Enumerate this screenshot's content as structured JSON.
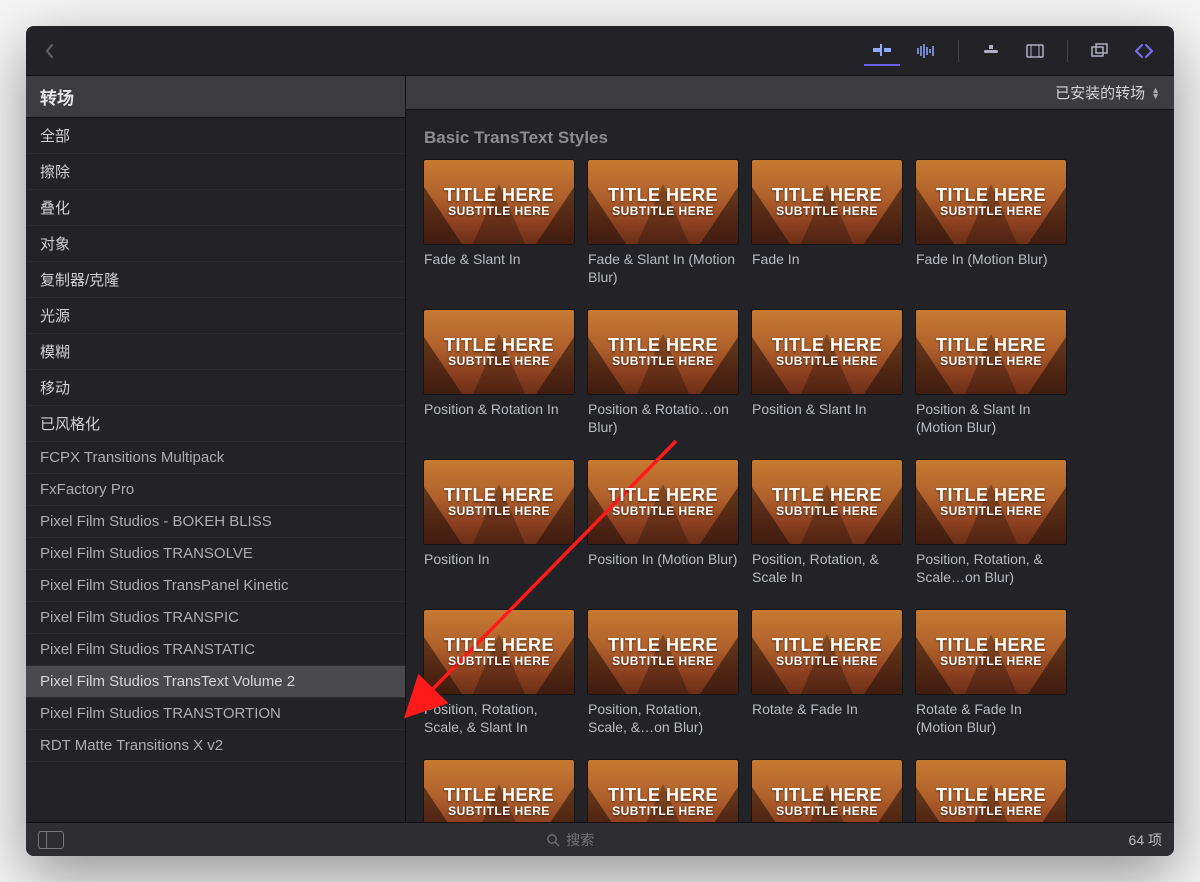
{
  "header": {
    "filter_label": "已安装的转场"
  },
  "sidebar": {
    "title": "转场",
    "items": [
      {
        "label": "全部",
        "top": true
      },
      {
        "label": "擦除",
        "top": true
      },
      {
        "label": "叠化",
        "top": true
      },
      {
        "label": "对象",
        "top": true
      },
      {
        "label": "复制器/克隆",
        "top": true
      },
      {
        "label": "光源",
        "top": true
      },
      {
        "label": "模糊",
        "top": true
      },
      {
        "label": "移动",
        "top": true
      },
      {
        "label": "已风格化",
        "top": true
      },
      {
        "label": "FCPX Transitions Multipack"
      },
      {
        "label": "FxFactory Pro"
      },
      {
        "label": "Pixel Film Studios - BOKEH BLISS"
      },
      {
        "label": "Pixel Film Studios TRANSOLVE"
      },
      {
        "label": "Pixel Film Studios TransPanel Kinetic"
      },
      {
        "label": "Pixel Film Studios TRANSPIC"
      },
      {
        "label": "Pixel Film Studios TRANSTATIC"
      },
      {
        "label": "Pixel Film Studios TransText Volume 2",
        "selected": true
      },
      {
        "label": "Pixel Film Studios TRANSTORTION"
      },
      {
        "label": "RDT Matte Transitions X v2"
      }
    ]
  },
  "content": {
    "group_title": "Basic TransText Styles",
    "thumb_title": "TITLE HERE",
    "thumb_subtitle": "SUBTITLE HERE",
    "cards": [
      {
        "label": "Fade & Slant In"
      },
      {
        "label": "Fade & Slant In (Motion Blur)"
      },
      {
        "label": "Fade In"
      },
      {
        "label": "Fade In (Motion Blur)"
      },
      {
        "label": "Position & Rotation In"
      },
      {
        "label": "Position & Rotatio…on Blur)"
      },
      {
        "label": "Position & Slant In"
      },
      {
        "label": "Position & Slant In (Motion Blur)"
      },
      {
        "label": "Position In"
      },
      {
        "label": "Position In (Motion Blur)"
      },
      {
        "label": "Position, Rotation, & Scale In"
      },
      {
        "label": "Position, Rotation, & Scale…on Blur)"
      },
      {
        "label": "Position, Rotation, Scale, & Slant In"
      },
      {
        "label": "Position, Rotation, Scale, &…on Blur)"
      },
      {
        "label": "Rotate & Fade In"
      },
      {
        "label": "Rotate & Fade In (Motion Blur)"
      },
      {
        "label": ""
      },
      {
        "label": ""
      },
      {
        "label": ""
      },
      {
        "label": ""
      }
    ]
  },
  "footer": {
    "search_placeholder": "搜索",
    "count_label": "64 项"
  }
}
